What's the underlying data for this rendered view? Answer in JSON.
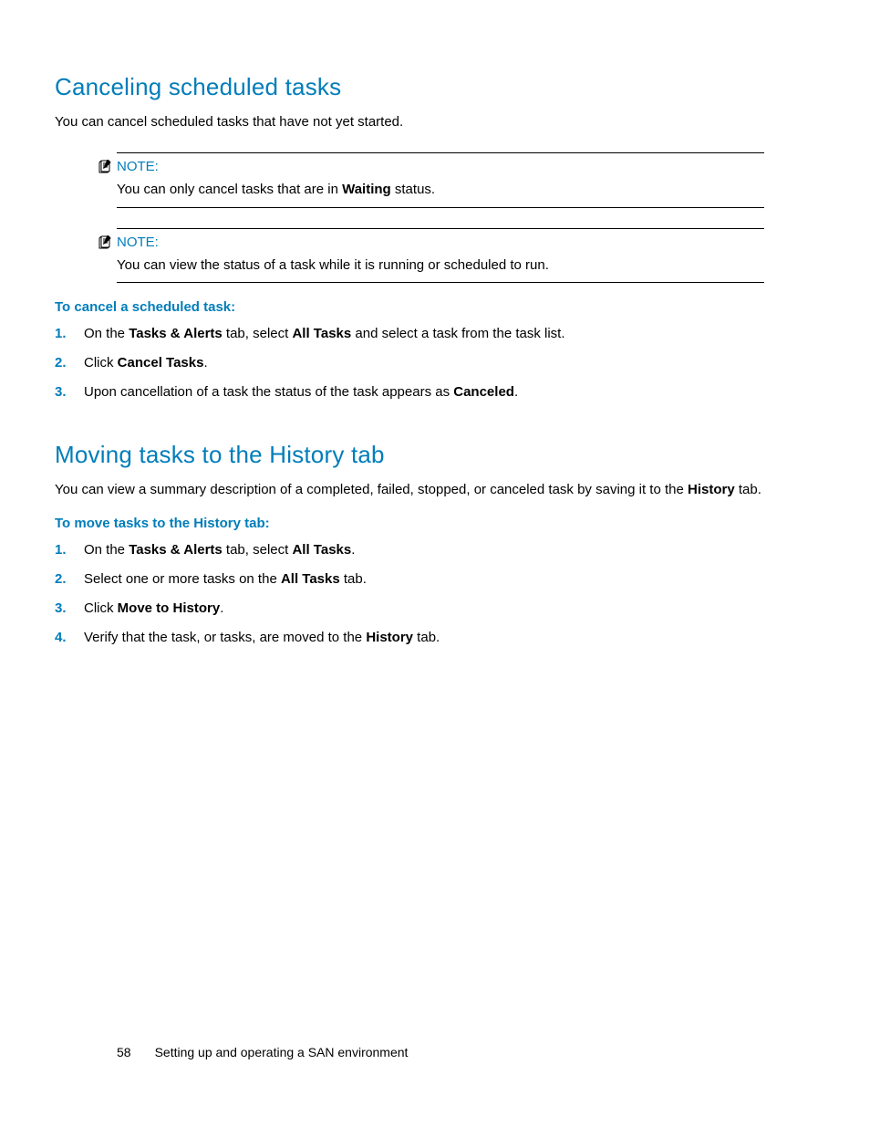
{
  "section1": {
    "title": "Canceling scheduled tasks",
    "intro": "You can cancel scheduled tasks that have not yet started.",
    "note1": {
      "label": "NOTE:",
      "text_pre": "You can only cancel tasks that are in ",
      "text_bold": "Waiting",
      "text_post": " status."
    },
    "note2": {
      "label": "NOTE:",
      "text": "You can view the status of a task while it is running or scheduled to run."
    },
    "subhead": "To cancel a scheduled task:",
    "steps": {
      "s1_a": "On the ",
      "s1_b1": "Tasks & Alerts",
      "s1_c": " tab, select ",
      "s1_b2": "All Tasks",
      "s1_d": " and select a task from the task list.",
      "s2_a": "Click ",
      "s2_b": "Cancel Tasks",
      "s2_c": ".",
      "s3_a": "Upon cancellation of a task the status of the task appears as ",
      "s3_b": "Canceled",
      "s3_c": "."
    }
  },
  "section2": {
    "title": "Moving tasks to the History tab",
    "intro_a": "You can view a summary description of a completed, failed, stopped, or canceled task by saving it to the ",
    "intro_b": "History",
    "intro_c": " tab.",
    "subhead": "To move tasks to the History tab:",
    "steps": {
      "s1_a": "On the ",
      "s1_b1": "Tasks & Alerts",
      "s1_c": " tab, select ",
      "s1_b2": "All Tasks",
      "s1_d": ".",
      "s2_a": "Select one or more tasks on the ",
      "s2_b": "All Tasks",
      "s2_c": " tab.",
      "s3_a": "Click ",
      "s3_b": "Move to History",
      "s3_c": ".",
      "s4_a": "Verify that the task, or tasks, are moved to the ",
      "s4_b": "History",
      "s4_c": " tab."
    }
  },
  "footer": {
    "page": "58",
    "chapter": "Setting up and operating a SAN environment"
  }
}
